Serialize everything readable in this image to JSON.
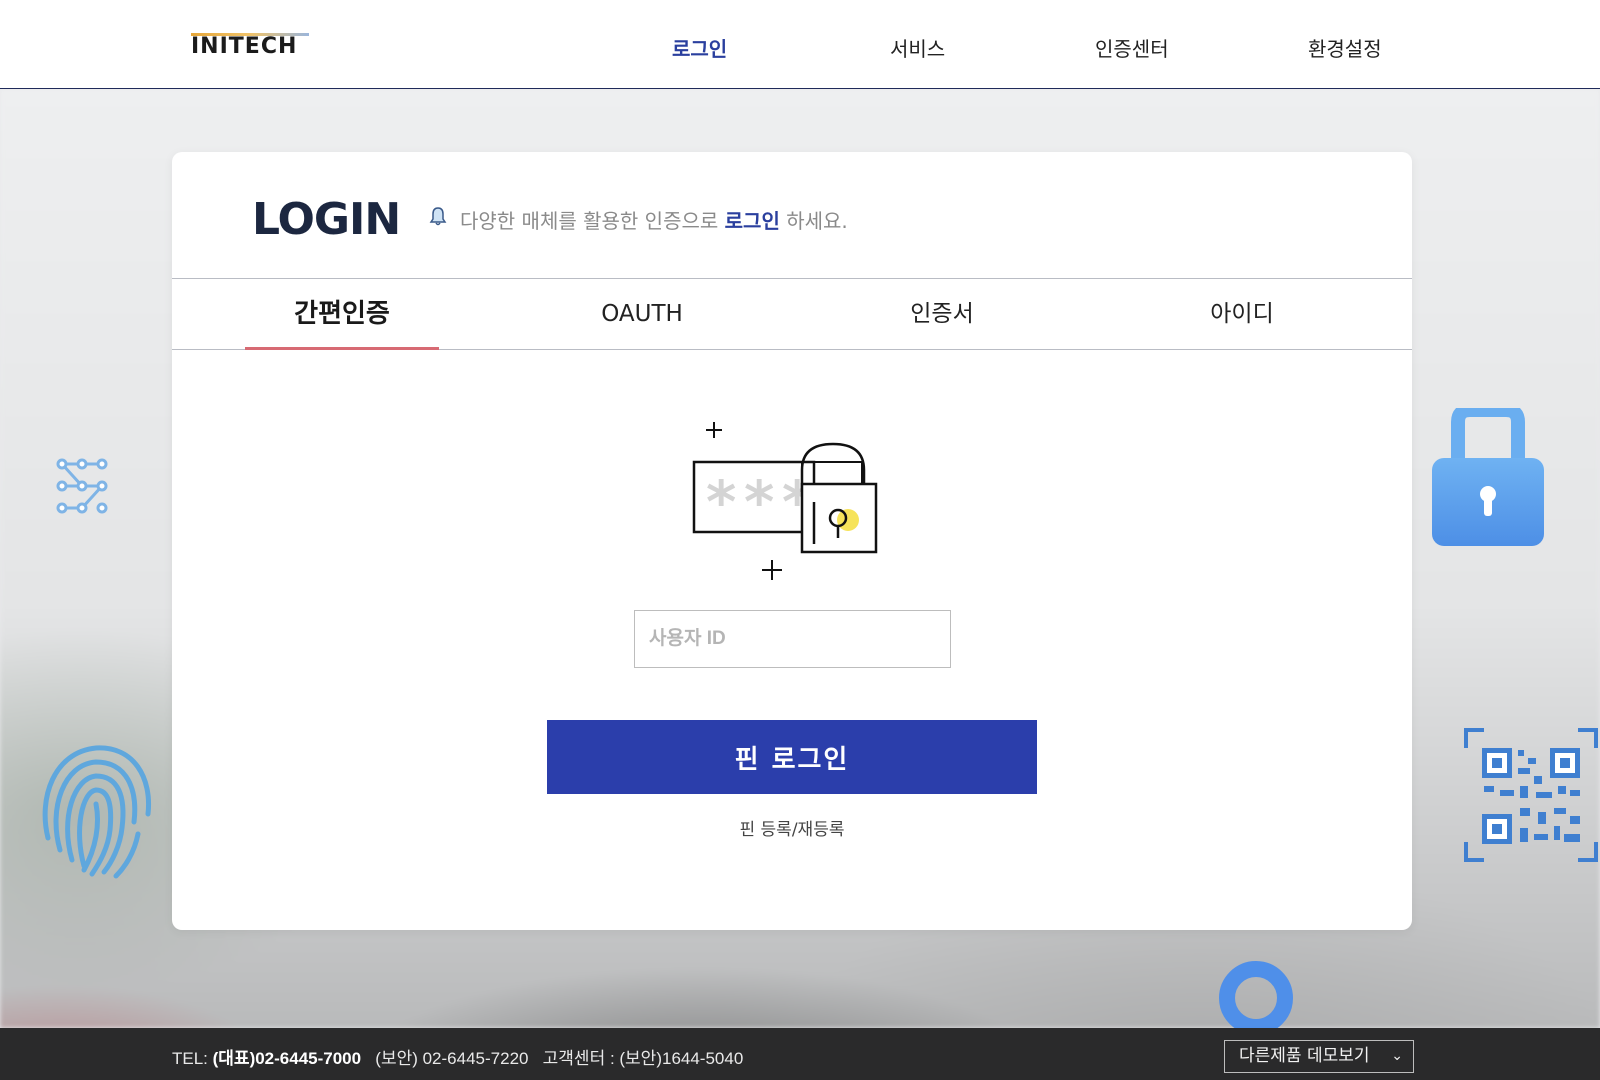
{
  "header": {
    "logo_text": "INITECH",
    "nav": [
      {
        "label": "로그인",
        "active": true
      },
      {
        "label": "서비스",
        "active": false
      },
      {
        "label": "인증센터",
        "active": false
      },
      {
        "label": "환경설정",
        "active": false
      }
    ]
  },
  "login": {
    "title": "LOGIN",
    "subtitle_prefix": "다양한 매체를 활용한 인증으로 ",
    "subtitle_highlight": "로그인",
    "subtitle_suffix": " 하세요.",
    "tabs": [
      {
        "label": "간편인증",
        "active": true
      },
      {
        "label": "OAUTH",
        "active": false
      },
      {
        "label": "인증서",
        "active": false
      },
      {
        "label": "아이디",
        "active": false
      }
    ],
    "userid_placeholder": "사용자 ID",
    "userid_value": "",
    "pin_button": "핀 로그인",
    "pin_register": "핀 등록/재등록"
  },
  "footer": {
    "tel_label": "TEL: ",
    "tel_main": "(대표)02-6445-7000",
    "tel_security": "(보안) 02-6445-7220",
    "customer_center": "고객센터 : (보안)1644-5040",
    "demo_select": "다른제품 데모보기"
  },
  "colors": {
    "accent": "#2b3eab",
    "nav_active": "#2a3f9e",
    "tab_underline": "#d76a73",
    "footer_bg": "#2a2a2b",
    "deco_blue": "#5aa3ea"
  },
  "icons": [
    "bell-icon",
    "password-lock-illustration",
    "pattern-icon",
    "fingerprint-icon",
    "padlock-icon",
    "qr-code-icon",
    "ring-icon",
    "chevron-down-icon"
  ]
}
